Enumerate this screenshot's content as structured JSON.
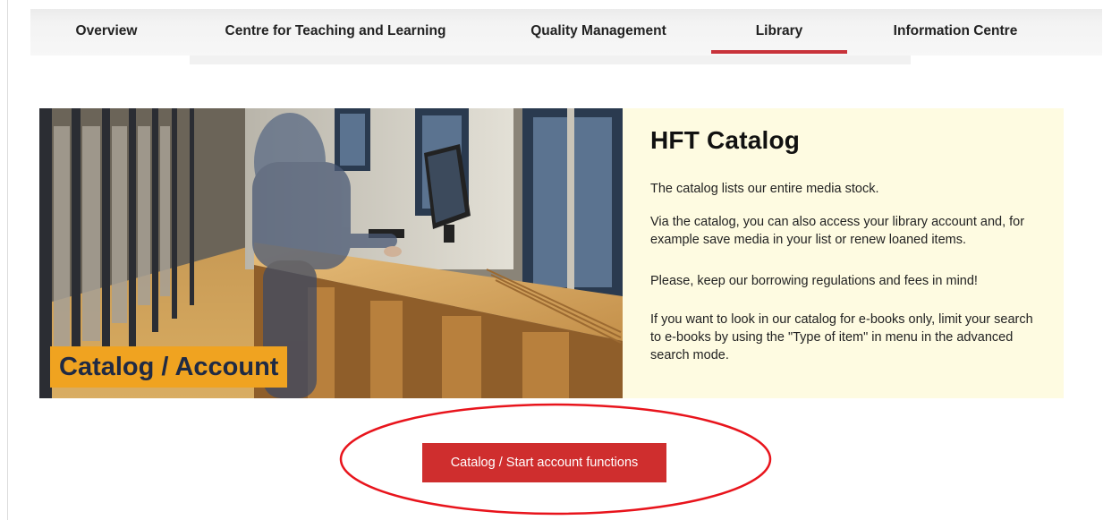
{
  "nav": {
    "items": [
      {
        "label": "Overview"
      },
      {
        "label": "Centre for Teaching and Learning"
      },
      {
        "label": "Quality Management"
      },
      {
        "label": "Library",
        "active": true
      },
      {
        "label": "Information Centre"
      }
    ]
  },
  "hero": {
    "caption": "Catalog / Account"
  },
  "catalog": {
    "title": "HFT Catalog",
    "paragraphs": [
      "The catalog lists our entire media stock.",
      "Via the catalog, you can also access your library account and, for example save media in your list or renew loaned items.",
      "Please, keep our borrowing regulations and fees in mind!",
      "If you want to look in our catalog for e-books only, limit your search to e-books by using the \"Type of item\" in menu in the advanced search mode."
    ]
  },
  "cta": {
    "label": "Catalog / Start account functions"
  },
  "colors": {
    "accent_red": "#cf2e2e",
    "active_underline": "#c8323a",
    "caption_background": "#f0a320",
    "panel_background": "#fefbe1",
    "annotation": "#e8141c"
  }
}
